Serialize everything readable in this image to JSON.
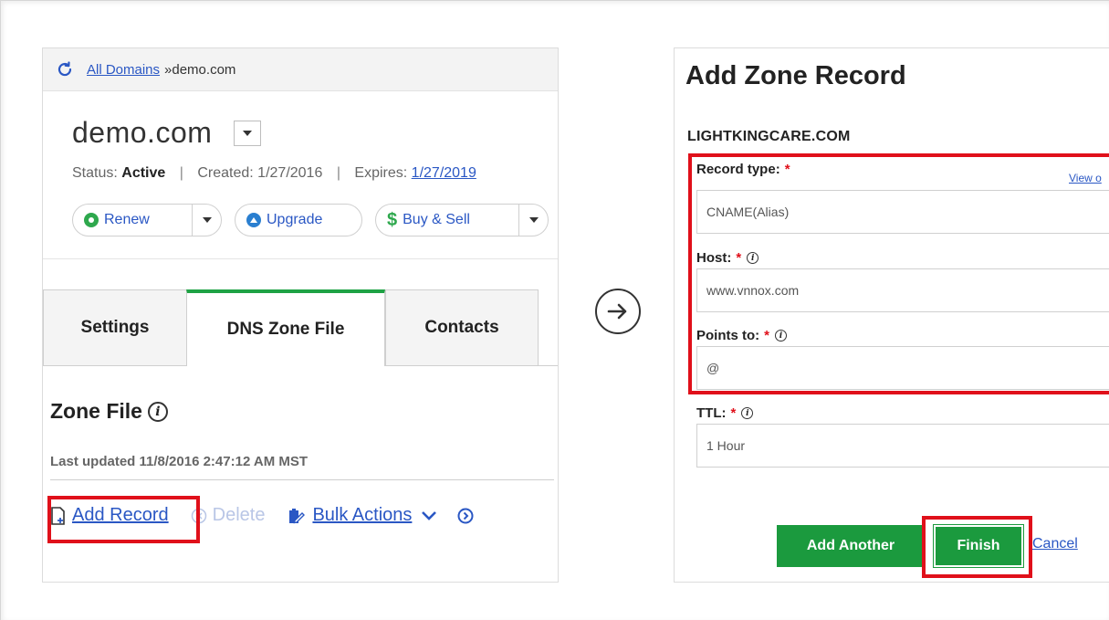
{
  "breadcrumb": {
    "link": "All Domains",
    "separator": "»",
    "current": "demo.com"
  },
  "domain": {
    "name": "demo.com",
    "status_label": "Status:",
    "status_value": "Active",
    "created_label": "Created: 1/27/2016",
    "expires_label": "Expires:",
    "expires_value": "1/27/2019",
    "separator": "|"
  },
  "actions": {
    "renew": "Renew",
    "upgrade": "Upgrade",
    "buy_sell": "Buy & Sell",
    "colors": {
      "renew": "#2ea84d",
      "upgrade": "#2a7fd0",
      "buy_sell": "#2ea84d"
    }
  },
  "tabs": [
    {
      "label": "Settings",
      "active": false
    },
    {
      "label": "DNS Zone File",
      "active": true
    },
    {
      "label": "Contacts",
      "active": false
    }
  ],
  "zone": {
    "title": "Zone File",
    "last_updated": "Last updated 11/8/2016 2:47:12 AM MST",
    "add_record": "Add Record",
    "delete": "Delete",
    "bulk_actions": "Bulk Actions"
  },
  "form": {
    "title": "Add Zone Record",
    "domain": "LIGHTKINGCARE.COM",
    "record_type_label": "Record type:",
    "record_type_value": "CNAME(Alias)",
    "view_link": "View o",
    "host_label": "Host:",
    "host_value": "www.vnnox.com",
    "points_to_label": "Points to:",
    "points_to_value": "@",
    "ttl_label": "TTL:",
    "ttl_value": "1 Hour",
    "required_mark": "*",
    "add_another": "Add Another",
    "finish": "Finish",
    "cancel": "Cancel"
  },
  "theme": {
    "accent_green": "#1b9a3e",
    "link_blue": "#2a57c4",
    "highlight_red": "#e0101a"
  }
}
